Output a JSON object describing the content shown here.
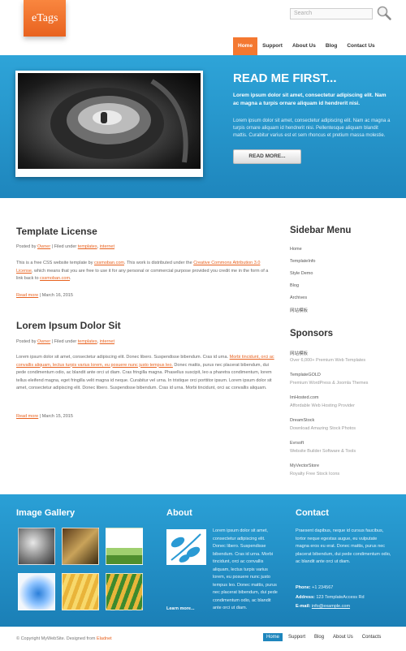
{
  "header": {
    "logo": "eTags",
    "search_placeholder": "Search",
    "nav": [
      "Home",
      "Support",
      "About Us",
      "Blog",
      "Contact Us"
    ]
  },
  "hero": {
    "title": "READ ME FIRST...",
    "lead": "Lorem ipsum dolor sit amet, consectetur adipiscing elit. Nam ac magna a turpis ornare aliquam id hendrerit nisi.",
    "body": "Lorem ipsum dolor sit amet, consectetur adipiscing elit. Nam ac magna a turpis ornare aliquam id hendrerit nisi. Pellentesque aliquam blandit mattis. Curabitur varius est et sem rhoncus et pretium massa molestie.",
    "button": "READ MORE..."
  },
  "posts": [
    {
      "title": "Template License",
      "meta_prefix": "Posted by ",
      "author": "Owner",
      "meta_mid": " | Filed under ",
      "tag1": "templates",
      "sep": ", ",
      "tag2": "internet",
      "body_a": "This is a free CSS website template by ",
      "body_link1": "cssmoban.com",
      "body_b": ". This work is distributed under the ",
      "body_link2": "Creative Commons Attribution 3.0 License",
      "body_c": ", which means that you are free to use it for any personal or commercial purpose provided you credit me in the form of a link back to ",
      "body_link3": "cssmoban.com",
      "body_d": ".",
      "read_more": "Read more",
      "date": " | March 16, 2015"
    },
    {
      "title": "Lorem Ipsum Dolor Sit",
      "meta_prefix": "Posted by ",
      "author": "Owner",
      "meta_mid": " | Filed under ",
      "tag1": "templates",
      "sep": ", ",
      "tag2": "internet",
      "body_a": "Lorem ipsum dolor sit amet, consectetur adipiscing elit. Donec libero. Suspendisse bibendum. Cras id urna. ",
      "body_link": "Morbi tincidunt, orci ac convallis aliquam, lectus turpis varius lorem, eu posuere nunc justo tempus leo.",
      "body_b": " Donec mattis, purus nec placerat bibendum, dui pede condimentum odio, ac blandit ante orci ut diam. Cras fringilla magna. Phasellus suscipit, leo a pharetra condimentum, lorem tellus eleifend magna, eget fringilla velit magna id neque. Curabitur vel urna. In tristique orci porttitor ipsum. Lorem ipsum dolor sit amet, consectetur adipiscing elit. Donec libero. Suspendisse bibendum. Cras id urna. Morbi tincidunt, orci ac convallis aliquam.",
      "read_more": "Read more",
      "date": " | March 15, 2015"
    }
  ],
  "sidebar": {
    "menu_title": "Sidebar Menu",
    "menu": [
      "Home",
      "TemplateInfo",
      "Style Demo",
      "Blog",
      "Archives",
      "网站模板"
    ],
    "sponsors_title": "Sponsors",
    "sponsors": [
      {
        "name": "网站模板",
        "desc": "Over 6,000+ Premium Web Templates"
      },
      {
        "name": "TemplateGOLD",
        "desc": "Premium WordPress & Joomla Themes"
      },
      {
        "name": "ImHosted.com",
        "desc": "Affordable Web Hosting Provider"
      },
      {
        "name": "DreamStock",
        "desc": "Download Amazing Stock Photos"
      },
      {
        "name": "Evrsoft",
        "desc": "Website Builder Software & Tools"
      },
      {
        "name": "MyVectorStore",
        "desc": "Royalty Free Stock Icons"
      }
    ]
  },
  "footer": {
    "gallery_title": "Image Gallery",
    "about_title": "About",
    "about_text": "Lorem ipsum dolor sit amet, consectetur adipiscing elit. Donec libero. Suspendisse bibendum. Cras id urna. Morbi tincidunt, orci ac convallis aliquam, lectus turpis varius lorem, eu posuere nunc justo tempus leo. Donec mattis, purus nec placerat bibendum, dui pede condimentum odio, ac blandit ante orci ut diam.",
    "about_link": "Learn more...",
    "contact_title": "Contact",
    "contact_text": "Praesent dapibus, neque id cursus faucibus, tortor neque egestas augue, eu vulputate magna eros eu erat. Donec mattis, purus nec placerat bibendum, dui pede condimentum odio, ac blandit ante orci ut diam.",
    "phone_label": "Phone:",
    "phone": " +1 234567",
    "address_label": "Address:",
    "address": " 123 TemplateAccess Rd",
    "email_label": "E-mail:",
    "email": "info@example.com"
  },
  "bottom": {
    "copyright": "© Copyright MyWebSite. Designed from ",
    "designer": "Eladnet",
    "nav": [
      "Home",
      "Support",
      "Blog",
      "About Us",
      "Contacts"
    ]
  }
}
